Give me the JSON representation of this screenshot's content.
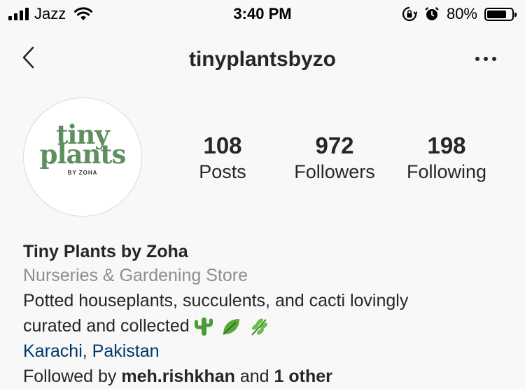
{
  "status_bar": {
    "carrier": "Jazz",
    "time": "3:40 PM",
    "battery_percent": "80%",
    "battery_level": 0.8
  },
  "header": {
    "username": "tinyplantsbyzo"
  },
  "profile": {
    "logo": {
      "line1": "tiny",
      "line2": "plants",
      "subtitle": "BY ZOHA"
    },
    "stats": [
      {
        "value": "108",
        "label": "Posts"
      },
      {
        "value": "972",
        "label": "Followers"
      },
      {
        "value": "198",
        "label": "Following"
      }
    ]
  },
  "bio": {
    "name": "Tiny Plants by Zoha",
    "category": "Nurseries & Gardening Store",
    "line1": "Potted houseplants, succulents, and cacti lovingly",
    "line2": "curated and collected",
    "emojis": [
      "cactus-emoji",
      "leaf-emoji",
      "herb-emoji"
    ],
    "location": "Karachi, Pakistan",
    "followed_by_prefix": "Followed by",
    "followed_by_name": "meh.rishkhan",
    "followed_by_suffix": "and",
    "followed_by_more": "1 other"
  },
  "colors": {
    "accent_green": "#5f8f5f",
    "link_blue": "#00376b",
    "muted_gray": "#8e8e8e"
  }
}
